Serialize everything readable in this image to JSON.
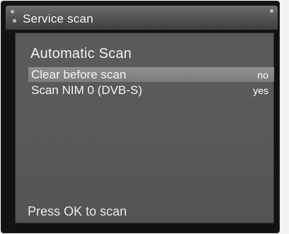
{
  "window": {
    "title": "Service scan"
  },
  "main": {
    "heading": "Automatic Scan",
    "options": [
      {
        "label": "Clear before scan",
        "value": "no",
        "selected": true
      },
      {
        "label": "Scan NIM 0 (DVB-S)",
        "value": "yes",
        "selected": false
      }
    ],
    "hint": "Press OK to scan"
  },
  "colors": {
    "title_bar": "#5a5a5a",
    "panel_background": "#585858",
    "selected_row": "#868686",
    "text": "#ffffff"
  }
}
